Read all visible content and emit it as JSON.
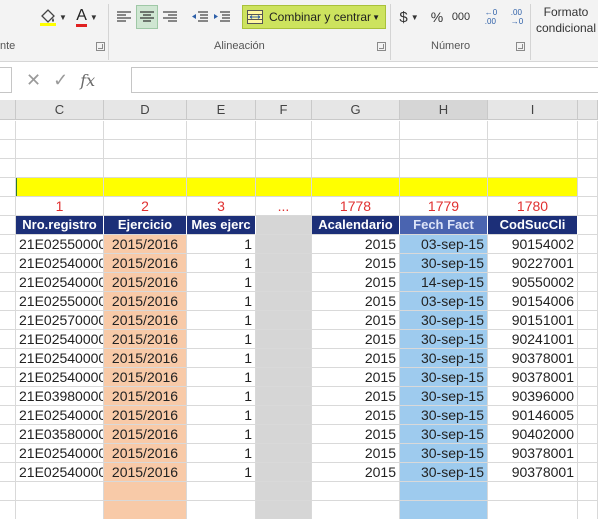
{
  "ribbon": {
    "font_group_label": "nte",
    "alignment_group_label": "Alineación",
    "number_group_label": "Número",
    "merge_button_label": "Combinar y centrar",
    "currency_symbol": "$",
    "percent_symbol": "%",
    "thousands_symbol": "000",
    "increase_decimal": "←0\n.00",
    "decrease_decimal": ".00\n→0",
    "conditional_format_line1": "Formato",
    "conditional_format_line2": "condicional",
    "font_color_letter": "A",
    "fill_color": "#ffff00",
    "font_color": "#e02020"
  },
  "formula_bar": {
    "cancel_symbol": "✕",
    "enter_symbol": "✓",
    "function_symbol": "fx",
    "value": ""
  },
  "columns": [
    "C",
    "D",
    "E",
    "F",
    "G",
    "H",
    "I"
  ],
  "sheet": {
    "index_row": [
      "1",
      "2",
      "3",
      "...",
      "1778",
      "1779",
      "1780"
    ],
    "headers": [
      "Nro.registro",
      "Ejercicio",
      "Mes ejerc",
      "",
      "Acalendario",
      "Fech Fact",
      "CodSucCli"
    ],
    "rows": [
      [
        "21E02550000",
        "2015/2016",
        "1",
        "",
        "2015",
        "03-sep-15",
        "90154002"
      ],
      [
        "21E02540000",
        "2015/2016",
        "1",
        "",
        "2015",
        "30-sep-15",
        "90227001"
      ],
      [
        "21E02540000",
        "2015/2016",
        "1",
        "",
        "2015",
        "14-sep-15",
        "90550002"
      ],
      [
        "21E02550000",
        "2015/2016",
        "1",
        "",
        "2015",
        "03-sep-15",
        "90154006"
      ],
      [
        "21E02570000",
        "2015/2016",
        "1",
        "",
        "2015",
        "30-sep-15",
        "90151001"
      ],
      [
        "21E02540000",
        "2015/2016",
        "1",
        "",
        "2015",
        "30-sep-15",
        "90241001"
      ],
      [
        "21E02540000",
        "2015/2016",
        "1",
        "",
        "2015",
        "30-sep-15",
        "90378001"
      ],
      [
        "21E02540000",
        "2015/2016",
        "1",
        "",
        "2015",
        "30-sep-15",
        "90378001"
      ],
      [
        "21E03980000",
        "2015/2016",
        "1",
        "",
        "2015",
        "30-sep-15",
        "90396000"
      ],
      [
        "21E02540000",
        "2015/2016",
        "1",
        "",
        "2015",
        "30-sep-15",
        "90146005"
      ],
      [
        "21E03580000",
        "2015/2016",
        "1",
        "",
        "2015",
        "30-sep-15",
        "90402000"
      ],
      [
        "21E02540000",
        "2015/2016",
        "1",
        "",
        "2015",
        "30-sep-15",
        "90378001"
      ],
      [
        "21E02540000",
        "2015/2016",
        "1",
        "",
        "2015",
        "30-sep-15",
        "90378001"
      ]
    ]
  }
}
